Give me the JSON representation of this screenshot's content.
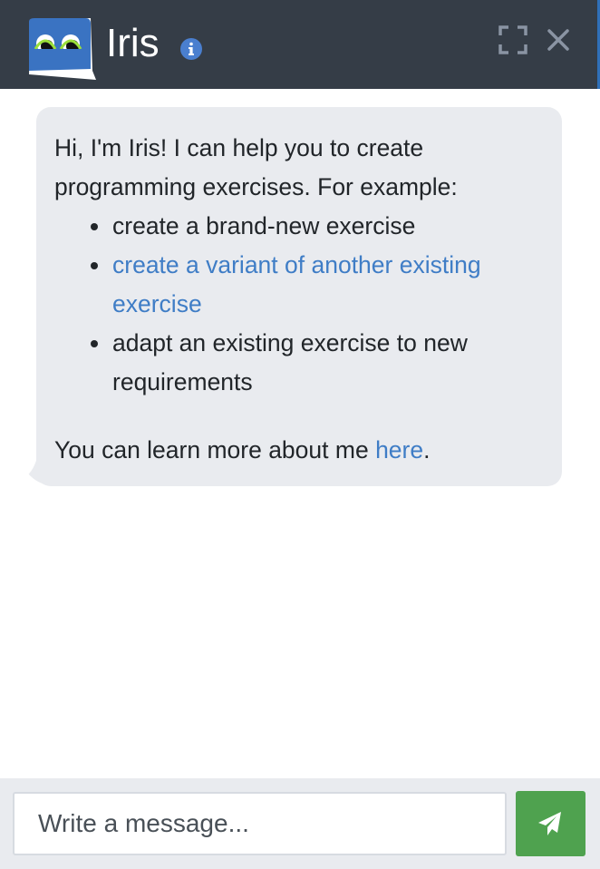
{
  "header": {
    "title": "Iris",
    "icons": [
      "iris-logo-icon",
      "info-icon",
      "expand-icon",
      "close-icon"
    ],
    "background_color": "#353d47"
  },
  "message": {
    "intro": "Hi, I'm Iris! I can help you to create programming exercises. For example:",
    "items": [
      {
        "text": "create a brand-new exercise",
        "is_link": false
      },
      {
        "text": "create a variant of another existing exercise",
        "is_link": true
      },
      {
        "text": "adapt an existing exercise to new requirements",
        "is_link": false
      }
    ],
    "learn_more_prefix": "You can learn more about me ",
    "learn_more_link": "here",
    "learn_more_suffix": ".",
    "bubble_color": "#e9ebef",
    "link_color": "#3f7dc6"
  },
  "composer": {
    "placeholder": "Write a message...",
    "value": "",
    "send_icon": "paper-plane-icon",
    "send_color": "#4fa24f"
  }
}
